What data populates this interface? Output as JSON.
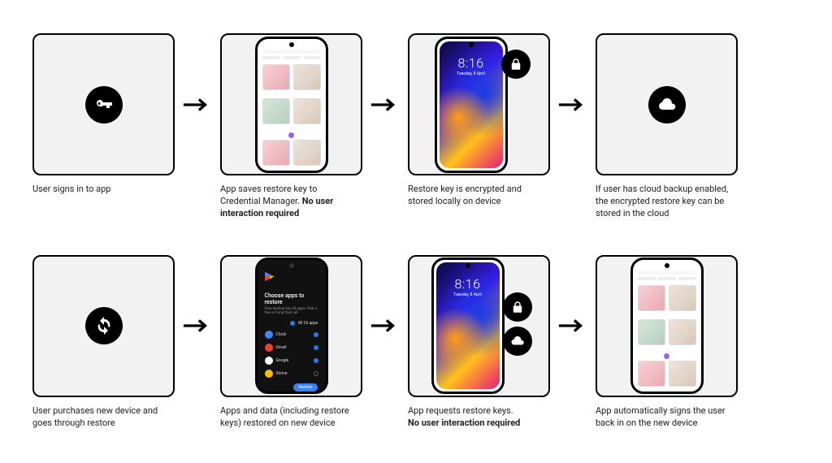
{
  "rows": [
    {
      "steps": [
        {
          "caption_plain": "User signs in to app",
          "caption_bold": ""
        },
        {
          "caption_plain": "App saves restore key to Credential Manager. ",
          "caption_bold": "No user interaction required"
        },
        {
          "caption_plain": "Restore key is encrypted and stored locally on device",
          "caption_bold": ""
        },
        {
          "caption_plain": "If user has cloud backup enabled, the encrypted restore key can be stored in the cloud",
          "caption_bold": ""
        }
      ]
    },
    {
      "steps": [
        {
          "caption_plain": "User purchases new device and goes through restore",
          "caption_bold": ""
        },
        {
          "caption_plain": "Apps and data (including restore keys) restored on new device",
          "caption_bold": ""
        },
        {
          "caption_plain": "App requests restore keys.",
          "caption_bold": "No user interaction required"
        },
        {
          "caption_plain": "App automatically signs the user back in on the new device",
          "caption_bold": ""
        }
      ]
    }
  ],
  "lockscreen": {
    "time": "8:16",
    "date": "Tuesday, 8 April"
  },
  "restore_screen": {
    "title": "Choose apps to restore",
    "subtitle": "Your backup has 26 apps. Pick a few or bring them all.",
    "all_apps_label": "All 26 apps",
    "apps": [
      "Clock",
      "Gmail",
      "Google",
      "Shrine"
    ],
    "button": "Restore"
  }
}
